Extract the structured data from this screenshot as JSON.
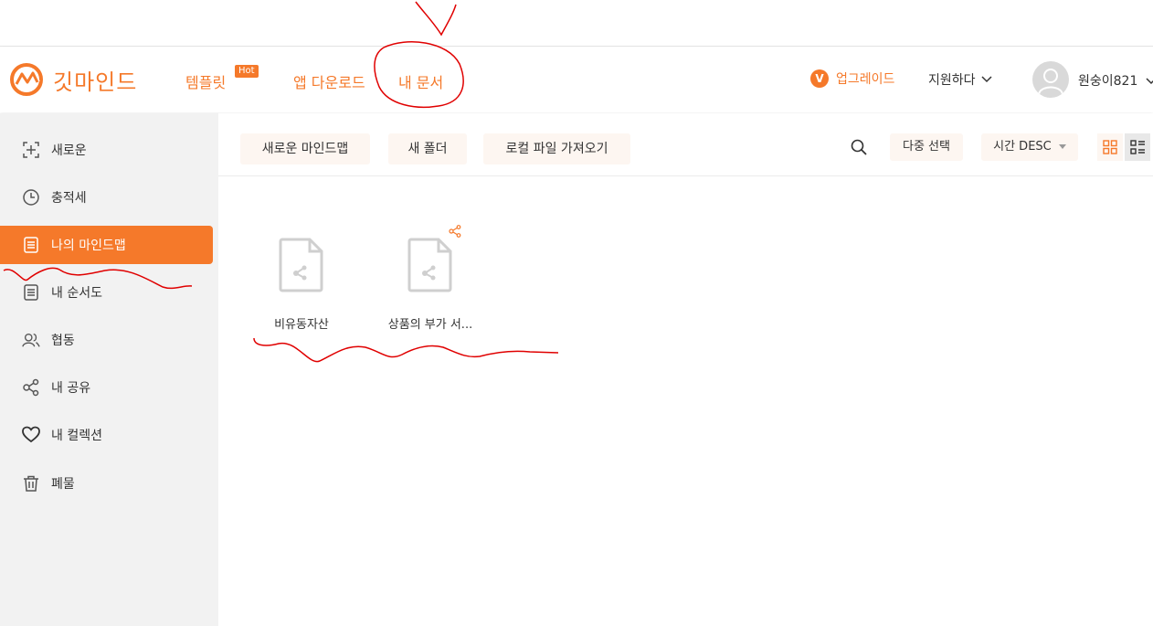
{
  "brand": {
    "name": "깃마인드",
    "accent": "#f5792a"
  },
  "nav": {
    "templates": "템플릿",
    "hot_badge": "Hot",
    "app_download": "앱 다운로드",
    "my_docs": "내 문서"
  },
  "header": {
    "upgrade": "업그레이드",
    "upgrade_badge": "V",
    "support": "지원하다",
    "username": "원숭이821"
  },
  "sidebar": {
    "items": [
      {
        "label": "새로운",
        "icon": "plus-square-icon"
      },
      {
        "label": "충적세",
        "icon": "clock-icon"
      },
      {
        "label": "나의 마인드맵",
        "icon": "document-icon",
        "active": true
      },
      {
        "label": "내 순서도",
        "icon": "document-icon"
      },
      {
        "label": "협동",
        "icon": "users-icon"
      },
      {
        "label": "내 공유",
        "icon": "share-icon"
      },
      {
        "label": "내 컬렉션",
        "icon": "heart-icon"
      },
      {
        "label": "폐물",
        "icon": "trash-icon"
      }
    ]
  },
  "toolbar": {
    "new_mindmap": "새로운 마인드맵",
    "new_folder": "새 폴더",
    "import_local": "로컬 파일 가져오기",
    "multi_select": "다중 선택",
    "sort": "시간 DESC"
  },
  "files": [
    {
      "name": "비유동자산",
      "shared": false
    },
    {
      "name": "상품의 부가 서...",
      "shared": true
    }
  ]
}
